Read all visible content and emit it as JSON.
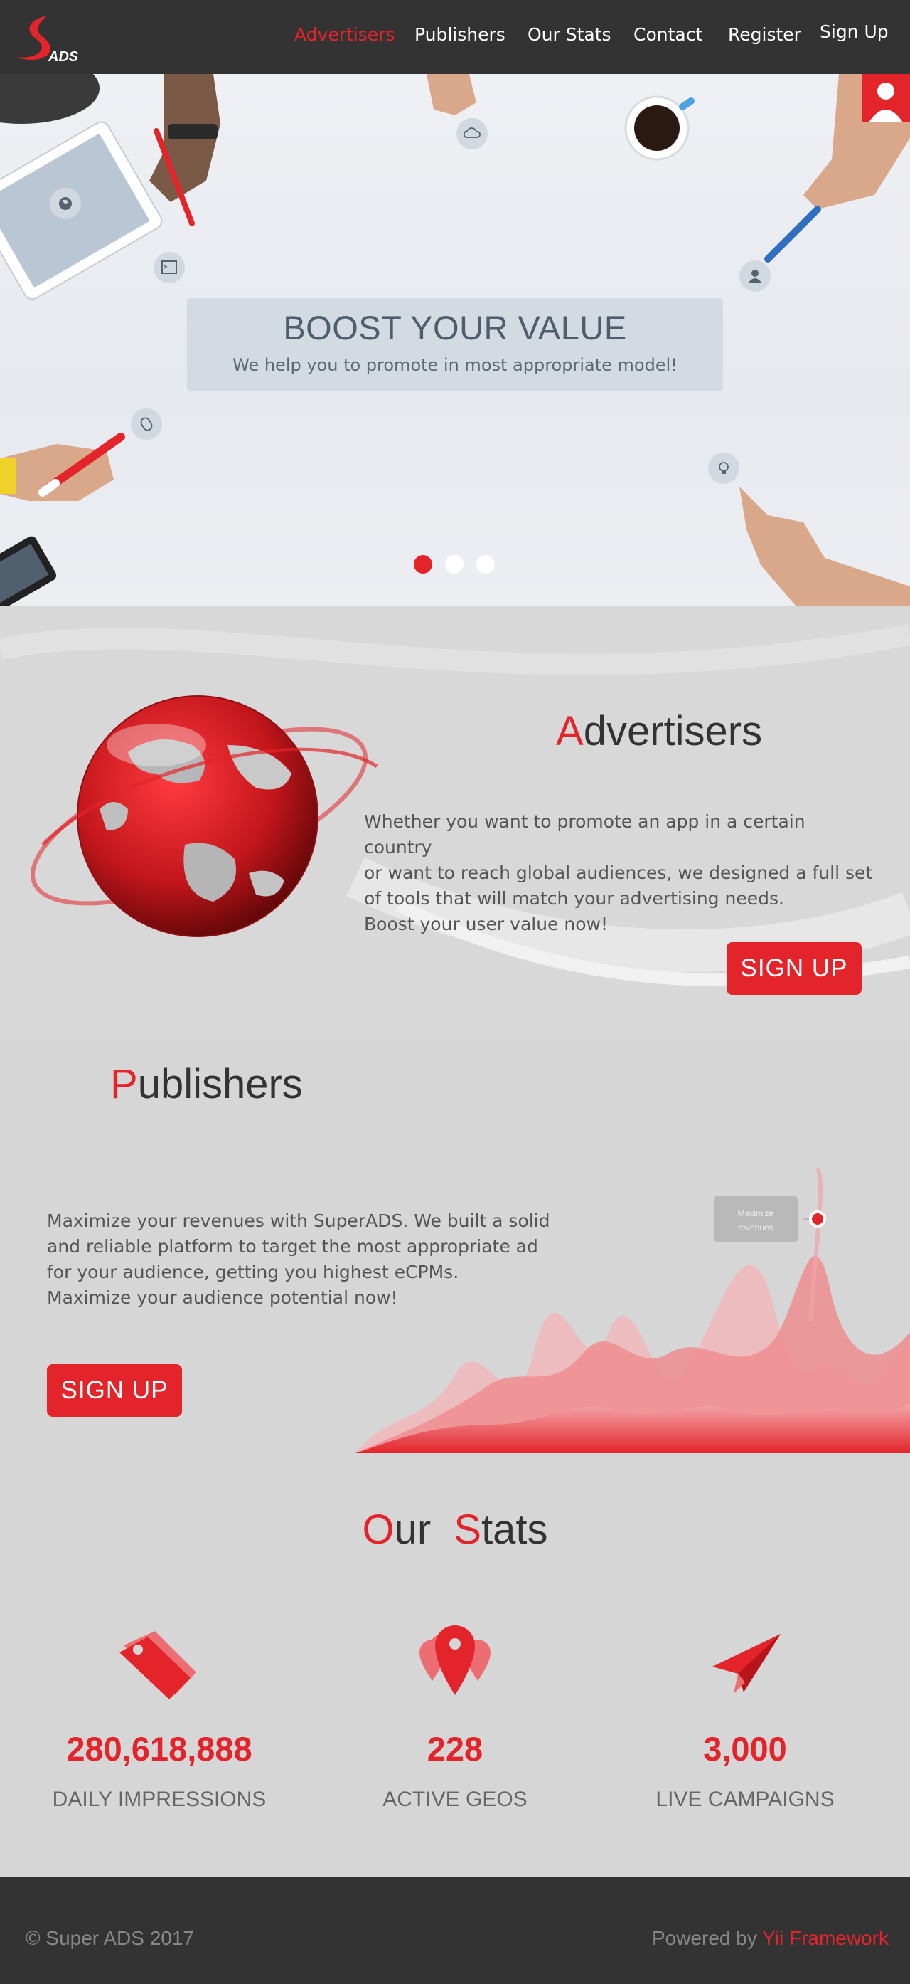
{
  "brand": {
    "logo_text": "ADS",
    "accent": "#e3242b",
    "dark": "#333333"
  },
  "nav": {
    "items": [
      {
        "label": "Advertisers",
        "active": true
      },
      {
        "label": "Publishers",
        "active": false
      },
      {
        "label": "Our Stats",
        "active": false
      },
      {
        "label": "Contact",
        "active": false
      },
      {
        "label": "Register",
        "active": false
      },
      {
        "label": "Sign Up",
        "active": false
      }
    ]
  },
  "hero": {
    "title": "BOOST YOUR VALUE",
    "subtitle": "We help you to promote in most appropriate model!",
    "slides": {
      "count": 3,
      "active": 1
    },
    "icons": [
      "globe-icon",
      "terminal-icon",
      "cloud-icon",
      "user-icon",
      "mouse-icon",
      "lightbulb-icon"
    ]
  },
  "advertisers": {
    "title_first": "A",
    "title_rest": "dvertisers",
    "lines": [
      "Whether you want to promote an app in a certain country",
      "or want to reach global audiences, we designed a full set",
      "of tools that will match your advertising needs.",
      "Boost your user value now!"
    ],
    "button": "SIGN  UP"
  },
  "publishers": {
    "title_first": "P",
    "title_rest": "ublishers",
    "lines": [
      "Maximize your revenues with SuperADS. We built a solid",
      "and reliable platform to target the most appropriate ad",
      "for your audience, getting you highest eCPMs.",
      "Maximize your audience potential now!"
    ],
    "button": "SIGN  UP",
    "chart_tooltip": [
      "Maximize",
      "revenues"
    ]
  },
  "stats": {
    "title_first_a": "O",
    "title_rest_a": "ur",
    "title_first_b": "S",
    "title_rest_b": "tats",
    "items": [
      {
        "value": "280,618,888",
        "label": "DAILY IMPRESSIONS",
        "icon": "tag-icon"
      },
      {
        "value": "228",
        "label": "ACTIVE GEOS",
        "icon": "map-pin-icon"
      },
      {
        "value": "3,000",
        "label": "LIVE CAMPAIGNS",
        "icon": "paper-plane-icon"
      }
    ]
  },
  "footer": {
    "copyright": "© Super ADS 2017",
    "powered_prefix": "Powered by ",
    "powered_link": "Yii Framework"
  }
}
